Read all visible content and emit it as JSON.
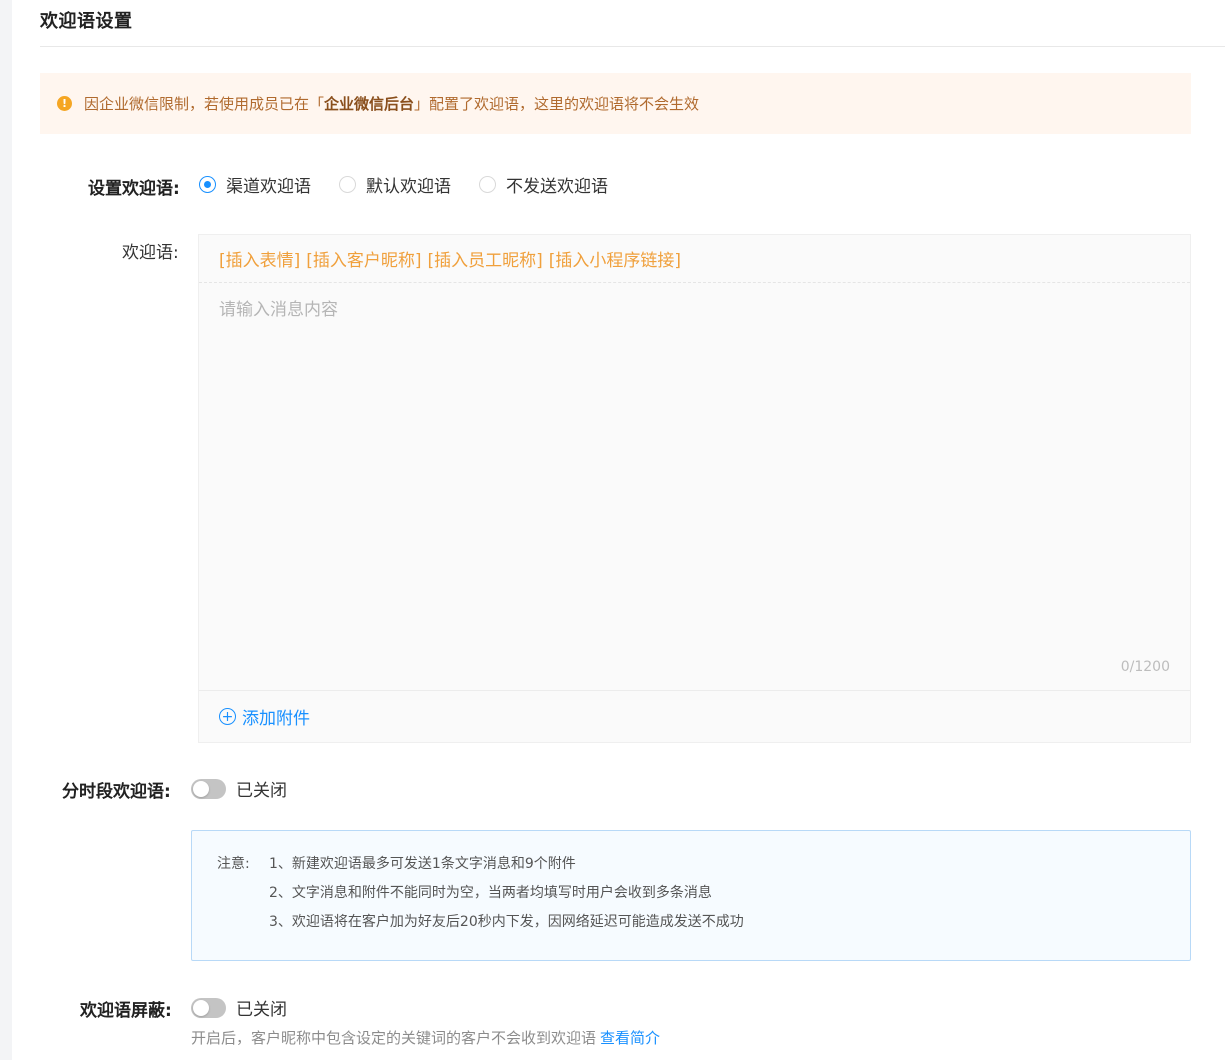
{
  "page": {
    "title": "欢迎语设置"
  },
  "alert": {
    "text_before": "因企业微信限制，若使用成员已在「",
    "highlight": "企业微信后台",
    "text_after": "」配置了欢迎语，这里的欢迎语将不会生效"
  },
  "welcome_type": {
    "label": "设置欢迎语:",
    "options": [
      "渠道欢迎语",
      "默认欢迎语",
      "不发送欢迎语"
    ],
    "selected": "渠道欢迎语"
  },
  "message": {
    "label": "欢迎语:",
    "toolbar": [
      "[插入表情]",
      "[插入客户昵称]",
      "[插入员工昵称]",
      "[插入小程序链接]"
    ],
    "placeholder": "请输入消息内容",
    "value": "",
    "char_count": "0/1200",
    "add_attachment": "添加附件"
  },
  "timed_welcome": {
    "label": "分时段欢迎语:",
    "status": "已关闭",
    "enabled": false
  },
  "notes": {
    "prefix": "注意:",
    "items": [
      "1、新建欢迎语最多可发送1条文字消息和9个附件",
      "2、文字消息和附件不能同时为空，当两者均填写时用户会收到多条消息",
      "3、欢迎语将在客户加为好友后20秒内下发，因网络延迟可能造成发送不成功"
    ]
  },
  "welcome_block": {
    "label": "欢迎语屏蔽:",
    "status": "已关闭",
    "enabled": false,
    "hint": "开启后，客户昵称中包含设定的关键词的客户不会收到欢迎语",
    "link": "查看简介"
  },
  "colors": {
    "accent": "#1890ff",
    "warning": "#f5a623",
    "toolbar": "#f0a03c"
  }
}
